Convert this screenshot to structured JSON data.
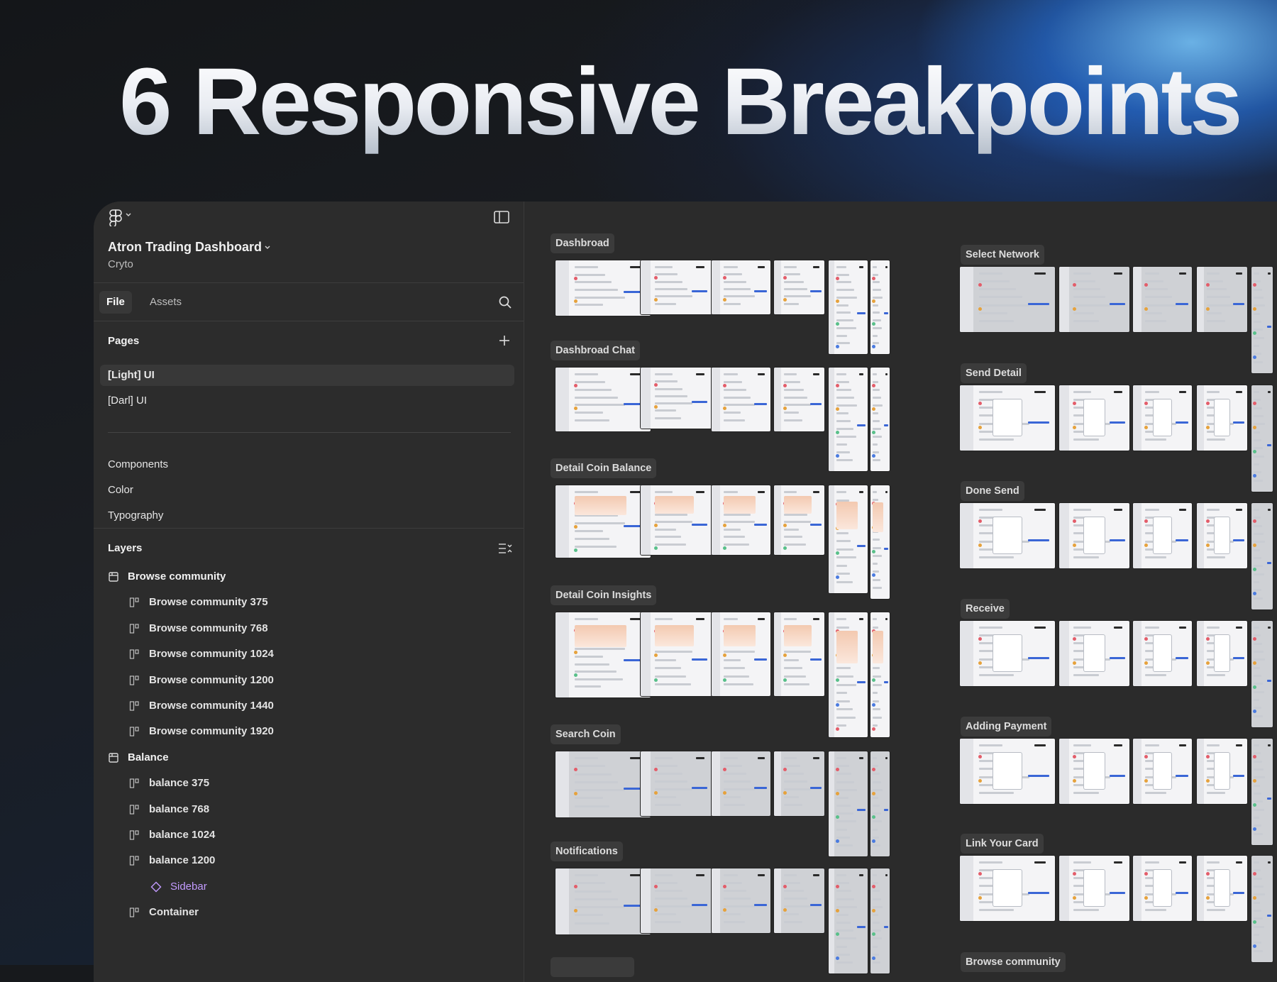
{
  "hero": {
    "title": "6 Responsive Breakpoints"
  },
  "project": {
    "title": "Atron Trading Dashboard",
    "subtitle": "Cryto"
  },
  "tabs": {
    "file": "File",
    "assets": "Assets"
  },
  "pages": {
    "title": "Pages",
    "items": [
      "[Light] UI",
      "[Darl] UI"
    ],
    "selected": "[Light] UI",
    "extra": [
      "Components",
      "Color",
      "Typography"
    ]
  },
  "layers": {
    "title": "Layers",
    "rows": [
      {
        "type": "group",
        "label": "Browse community"
      },
      {
        "type": "frame",
        "label": "Browse community 375"
      },
      {
        "type": "frame",
        "label": "Browse community 768"
      },
      {
        "type": "frame",
        "label": "Browse community 1024"
      },
      {
        "type": "frame",
        "label": "Browse community 1200"
      },
      {
        "type": "frame",
        "label": "Browse community 1440"
      },
      {
        "type": "frame",
        "label": "Browse community 1920"
      },
      {
        "type": "group",
        "label": "Balance"
      },
      {
        "type": "frame",
        "label": "balance 375"
      },
      {
        "type": "frame",
        "label": "balance 768"
      },
      {
        "type": "frame",
        "label": "balance 1024"
      },
      {
        "type": "frame",
        "label": "balance 1200"
      },
      {
        "type": "comp",
        "label": "Sidebar"
      },
      {
        "type": "frame",
        "label": "Container"
      }
    ]
  },
  "canvas": {
    "left_sections": [
      "Dashbroad",
      "Dashbroad Chat",
      "Detail Coin Balance",
      "Detail Coin Insights",
      "Search Coin",
      "Notifications",
      ""
    ],
    "right_sections": [
      "Select Network",
      "Send Detail",
      "Done Send",
      "Receive",
      "Adding Payment",
      "Link Your Card",
      "Browse community"
    ]
  },
  "colors": {
    "accent": "#3a66d6",
    "component": "#c39bff",
    "panel": "#2c2c2c"
  }
}
